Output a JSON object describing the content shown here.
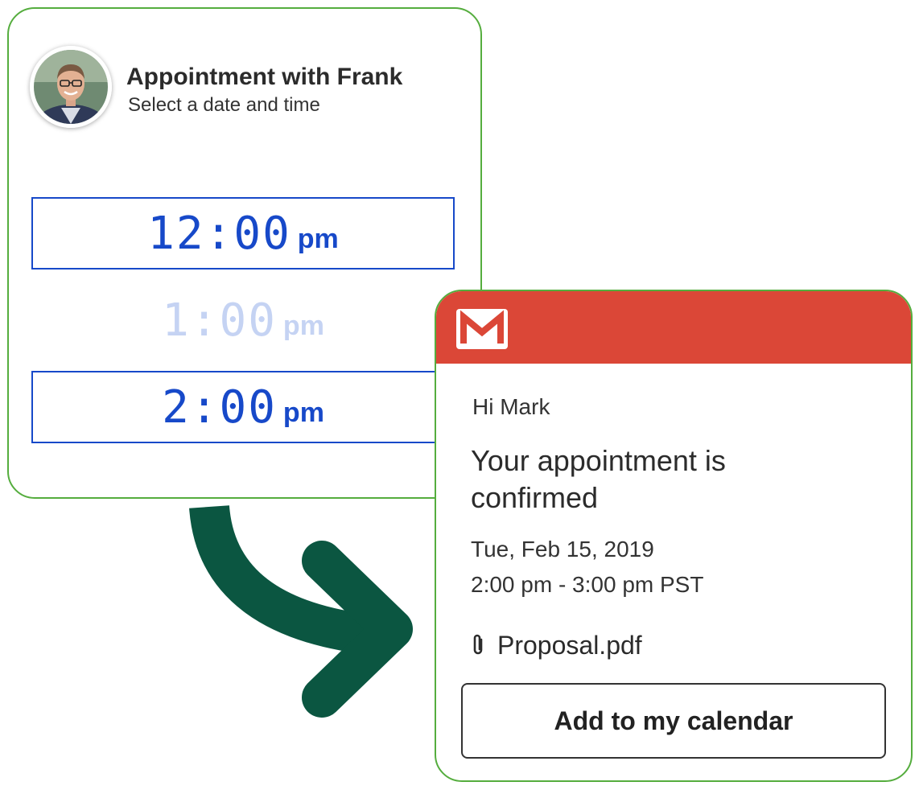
{
  "scheduler": {
    "title": "Appointment with Frank",
    "subtitle": "Select a date and time",
    "slots": [
      {
        "time": "12:00",
        "ampm": "pm"
      },
      {
        "time": "1:00",
        "ampm": "pm"
      },
      {
        "time": "2:00",
        "ampm": "pm"
      }
    ]
  },
  "email": {
    "app_icon": "gmail-icon",
    "greeting": "Hi Mark",
    "headline": "Your appointment is confirmed",
    "date": "Tue, Feb 15, 2019",
    "time": "2:00 pm - 3:00 pm PST",
    "attachment": {
      "icon": "paperclip-icon",
      "name": "Proposal.pdf"
    },
    "cta_label": "Add to my calendar"
  },
  "colors": {
    "card_border": "#55ad3e",
    "slot_blue": "#1749c9",
    "slot_faded": "#c5d3f3",
    "gmail_red": "#db4737",
    "arrow_green": "#0b5641"
  }
}
